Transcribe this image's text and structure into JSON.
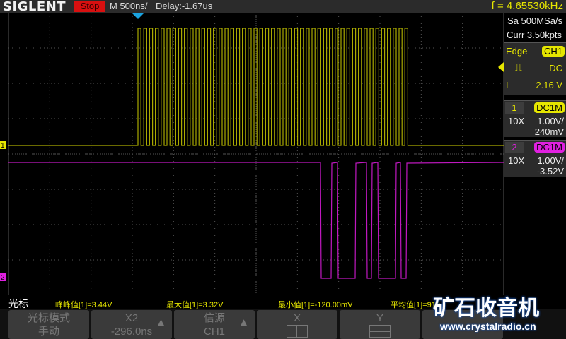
{
  "header": {
    "brand": "SIGLENT",
    "run_state": "Stop",
    "timebase": "M 500ns/",
    "delay": "Delay:-1.67us",
    "frequency": "f = 4.65530kHz"
  },
  "acquisition": {
    "sample_rate": "Sa 500MSa/s",
    "memory": "Curr 3.50kpts"
  },
  "trigger": {
    "type": "Edge",
    "source": "CH1",
    "coupling": "DC",
    "level_label": "L",
    "level": "2.16 V",
    "slope_icon": "rising-edge-icon"
  },
  "channels": [
    {
      "number": "1",
      "coupling": "DC1M",
      "probe": "10X",
      "scale": "1.00V/",
      "offset": "240mV",
      "color": "#e6e600"
    },
    {
      "number": "2",
      "coupling": "DC1M",
      "probe": "10X",
      "scale": "1.00V/",
      "offset": "-3.52V",
      "color": "#e020e0"
    }
  ],
  "markers": {
    "ch1": "1",
    "ch2": "2"
  },
  "measurements": {
    "title": "光标",
    "items": [
      "峰峰值[1]=3.44V",
      "最大值[1]=3.32V",
      "最小值[1]=-120.00mV",
      "平均值[1]=910"
    ]
  },
  "softkeys": [
    {
      "line1": "光标模式",
      "line2": "手动"
    },
    {
      "line1": "X2",
      "line2": "-296.0ns"
    },
    {
      "line1": "信源",
      "line2": "CH1"
    },
    {
      "line1": "X",
      "line2": ""
    },
    {
      "line1": "Y",
      "line2": ""
    },
    {
      "line1": "",
      "line2": ""
    }
  ],
  "watermark": {
    "title": "矿石收音机",
    "url": "www.crystalradio.cn"
  }
}
